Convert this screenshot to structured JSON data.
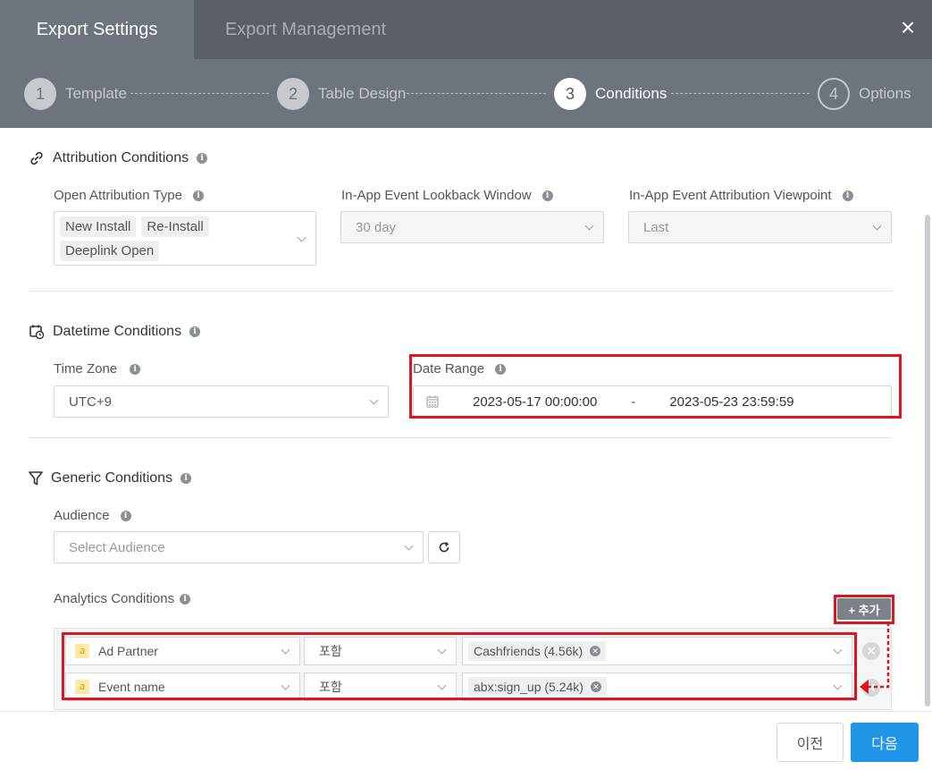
{
  "tabs": {
    "active": "Export Settings",
    "inactive": "Export Management",
    "close": "×"
  },
  "stepper": [
    {
      "number": "1",
      "label": "Template",
      "state": "done"
    },
    {
      "number": "2",
      "label": "Table Design",
      "state": "done"
    },
    {
      "number": "3",
      "label": "Conditions",
      "state": "current"
    },
    {
      "number": "4",
      "label": "Options",
      "state": "todo"
    }
  ],
  "attribution": {
    "title": "Attribution Conditions",
    "open_type_label": "Open Attribution Type",
    "open_type_tags": [
      "New Install",
      "Re-Install",
      "Deeplink Open"
    ],
    "lookback_label": "In-App Event Lookback Window",
    "lookback_value": "30 day",
    "viewpoint_label": "In-App Event Attribution Viewpoint",
    "viewpoint_value": "Last"
  },
  "datetime": {
    "title": "Datetime Conditions",
    "timezone_label": "Time Zone",
    "timezone_value": "UTC+9",
    "range_label": "Date Range",
    "range_start": "2023-05-17 00:00:00",
    "range_sep": "-",
    "range_end": "2023-05-23 23:59:59"
  },
  "generic": {
    "title": "Generic Conditions",
    "audience_label": "Audience",
    "audience_placeholder": "Select Audience",
    "analytics_label": "Analytics Conditions",
    "add_button": "+ 추가",
    "rows": [
      {
        "type_badge": "a",
        "field": "Ad Partner",
        "operator": "포함",
        "value": "Cashfriends (4.56k)"
      },
      {
        "type_badge": "a",
        "field": "Event name",
        "operator": "포함",
        "value": "abx:sign_up (5.24k)"
      }
    ]
  },
  "footer": {
    "prev": "이전",
    "next": "다음"
  },
  "colors": {
    "header": "#6e747c",
    "tabbar": "#5a5f66",
    "primary": "#2196e8",
    "highlight": "#e0141e"
  }
}
